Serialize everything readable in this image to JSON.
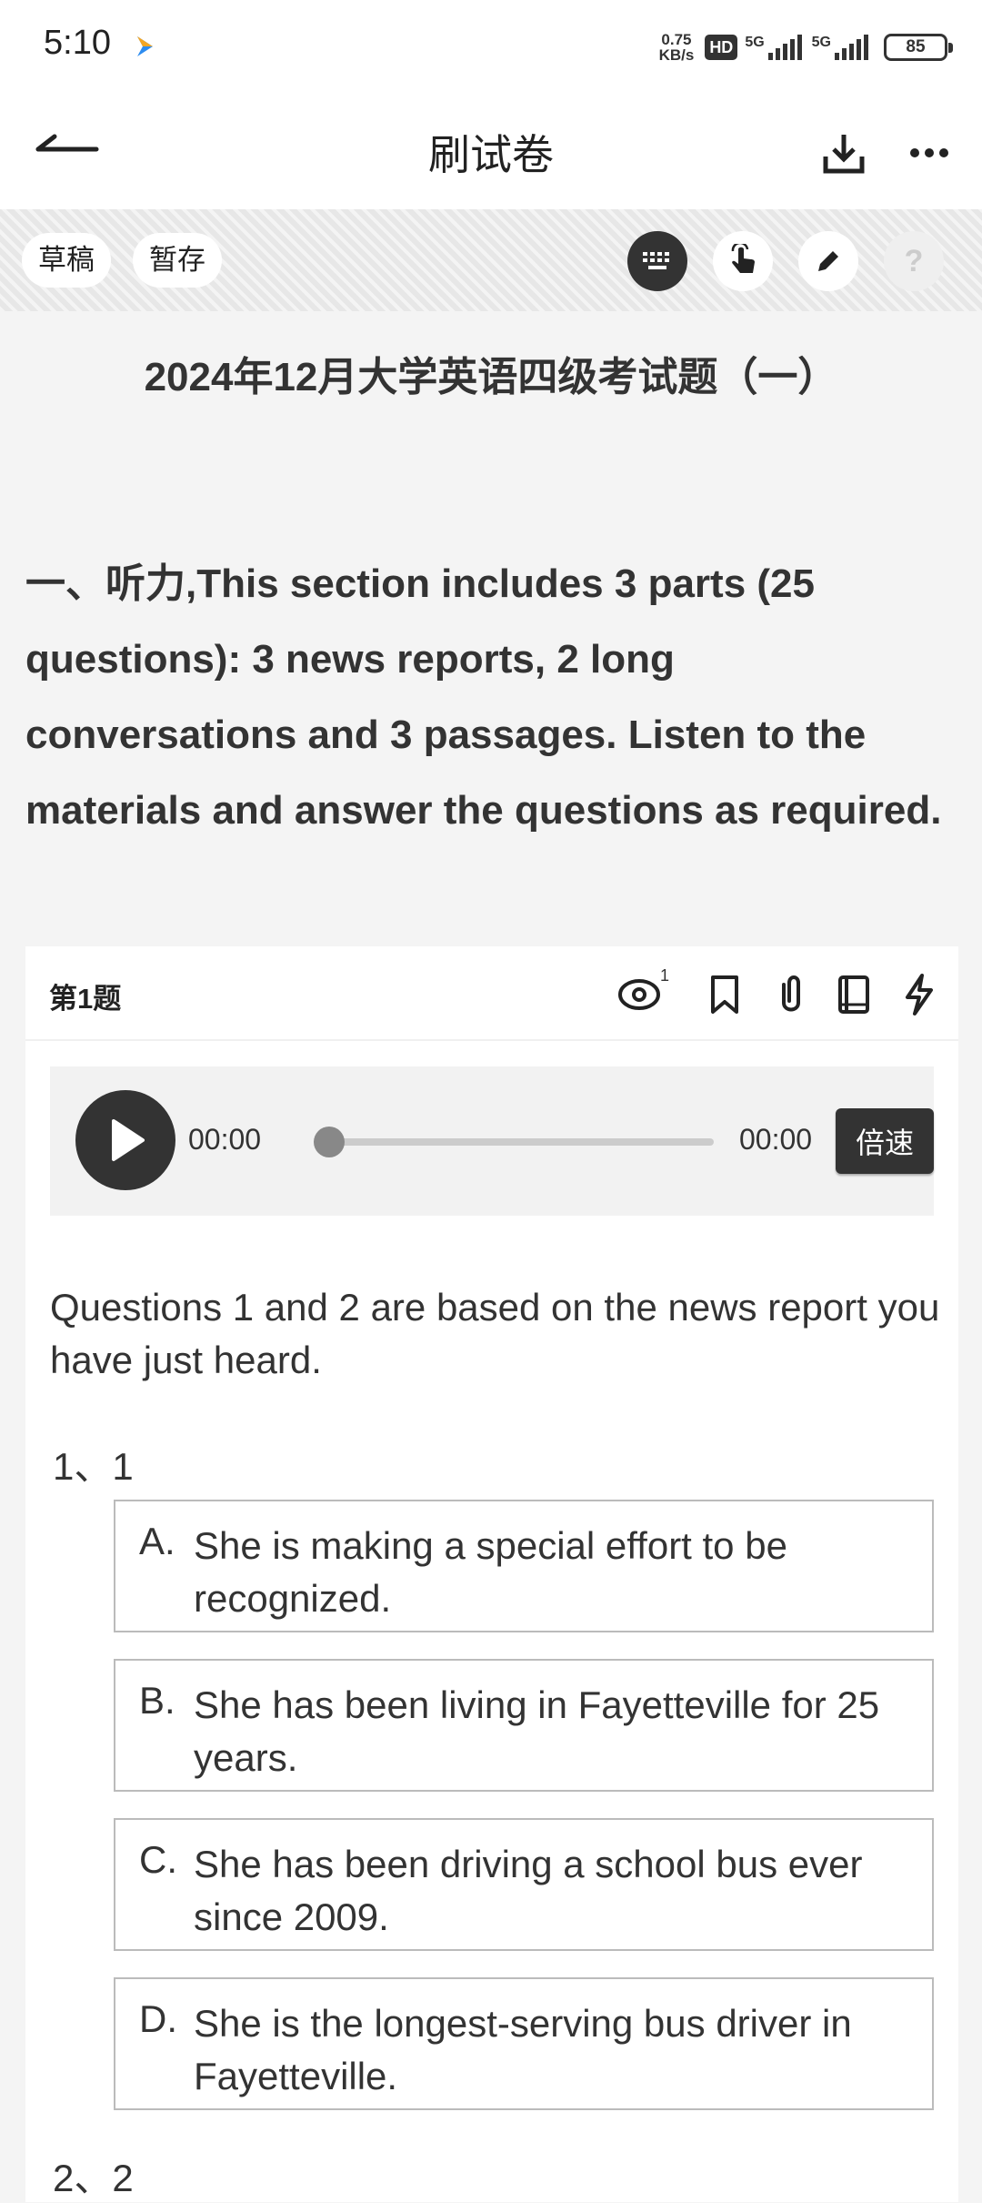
{
  "status_bar": {
    "time": "5:10",
    "net_speed_value": "0.75",
    "net_speed_unit": "KB/s",
    "hd_label": "HD",
    "signal1_label": "5G",
    "signal2_label": "5G",
    "battery": "85"
  },
  "header": {
    "title": "刷试卷"
  },
  "toolbar": {
    "draft_label": "草稿",
    "save_label": "暂存",
    "help_label": "?"
  },
  "paper": {
    "title": "2024年12月大学英语四级考试题（一）",
    "section_desc": "一、听力,This section includes 3 parts (25 questions): 3 news reports, 2 long conversations and 3 passages. Listen to the materials and answer the questions as required."
  },
  "question": {
    "number_label": "第1题",
    "view_count": "1",
    "audio": {
      "current_time": "00:00",
      "total_time": "00:00",
      "speed_label": "倍速",
      "progress": 0
    },
    "intro": "Questions 1 and 2 are based on the news report you have just heard.",
    "sub_questions": [
      {
        "label": "1、1",
        "options": [
          {
            "letter": "A.",
            "text": "She is making a special effort to be recognized."
          },
          {
            "letter": "B.",
            "text": "She has been living in Fayetteville for 25 years."
          },
          {
            "letter": "C.",
            "text": "She has been driving a school bus ever since 2009."
          },
          {
            "letter": "D.",
            "text": "She is the longest-serving bus driver in Fayetteville."
          }
        ]
      },
      {
        "label": "2、2",
        "options": []
      }
    ]
  },
  "colors": {
    "page_bg": "#f4f4f4",
    "dark": "#333333",
    "option_border": "#bbbbbb"
  },
  "icons": [
    "back-arrow-icon",
    "download-icon",
    "more-icon",
    "keyboard-icon",
    "touch-icon",
    "pen-icon",
    "help-icon",
    "eye-icon",
    "bookmark-icon",
    "paperclip-icon",
    "note-icon",
    "flash-icon",
    "play-icon"
  ]
}
